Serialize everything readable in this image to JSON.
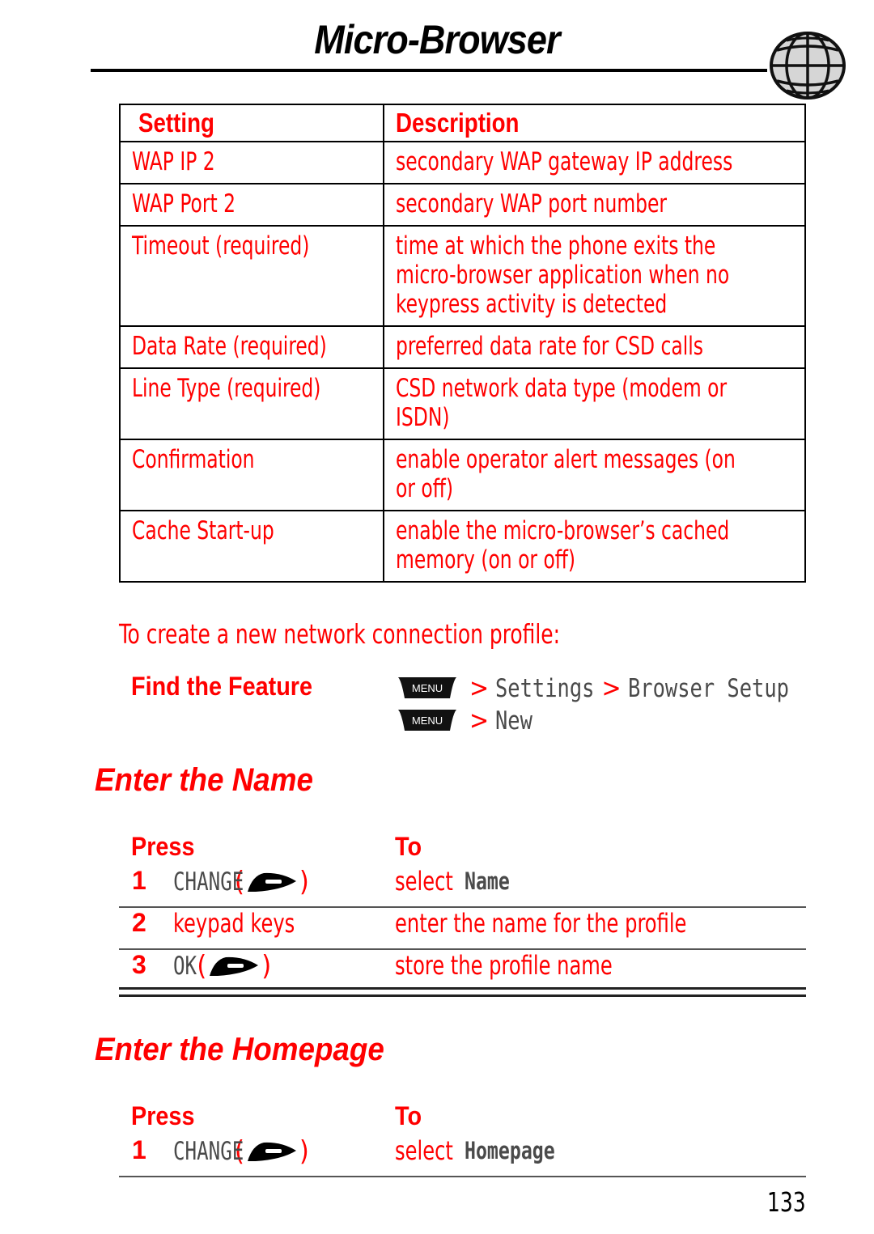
{
  "header": {
    "title": "Micro-Browser",
    "icon": "globe-icon"
  },
  "settings_table": {
    "columns": [
      "Setting",
      "Description"
    ],
    "rows": [
      {
        "setting": "WAP IP 2",
        "description": [
          "secondary WAP gateway IP address"
        ]
      },
      {
        "setting": "WAP Port 2",
        "description": [
          "secondary WAP port number"
        ]
      },
      {
        "setting": "Timeout (required)",
        "description": [
          "time at which the phone exits the",
          "micro-browser application when no",
          "keypress activity is detected"
        ]
      },
      {
        "setting": "Data Rate (required)",
        "description": [
          "preferred data rate for CSD calls"
        ]
      },
      {
        "setting": "Line Type (required)",
        "description": [
          "CSD network data type (modem or",
          "ISDN)"
        ]
      },
      {
        "setting": "Confirmation",
        "description": [
          "enable operator alert messages (on",
          "or off)"
        ]
      },
      {
        "setting": "Cache Start-up",
        "description": [
          "enable the micro-browser’s cached",
          "memory (on or off)"
        ]
      }
    ]
  },
  "intro": "To create a new network connection profile:",
  "find_feature": {
    "label": "Find the Feature",
    "menu_key_label": "MENU",
    "separator": ">",
    "path1": [
      "Settings",
      "Browser Setup"
    ],
    "path2": [
      "New"
    ]
  },
  "sections": {
    "enter_name": {
      "heading": "Enter the Name",
      "col_press": "Press",
      "col_to": "To",
      "steps": [
        {
          "num": "1",
          "press": "CHANGE",
          "has_softkey": true,
          "to_prefix": "select",
          "to_value": "Name"
        },
        {
          "num": "2",
          "press": "keypad keys",
          "has_softkey": false,
          "to_prefix": "enter the name for the profile",
          "to_value": ""
        },
        {
          "num": "3",
          "press": "OK",
          "has_softkey": true,
          "to_prefix": "store the profile name",
          "to_value": ""
        }
      ]
    },
    "enter_homepage": {
      "heading": "Enter the Homepage",
      "col_press": "Press",
      "col_to": "To",
      "steps": [
        {
          "num": "1",
          "press": "CHANGE",
          "has_softkey": true,
          "to_prefix": "select",
          "to_value": "Homepage"
        }
      ]
    }
  },
  "page_number": "133",
  "colors": {
    "accent": "#ff0000",
    "display_text": "#4a4a4a",
    "rule": "#000000"
  }
}
